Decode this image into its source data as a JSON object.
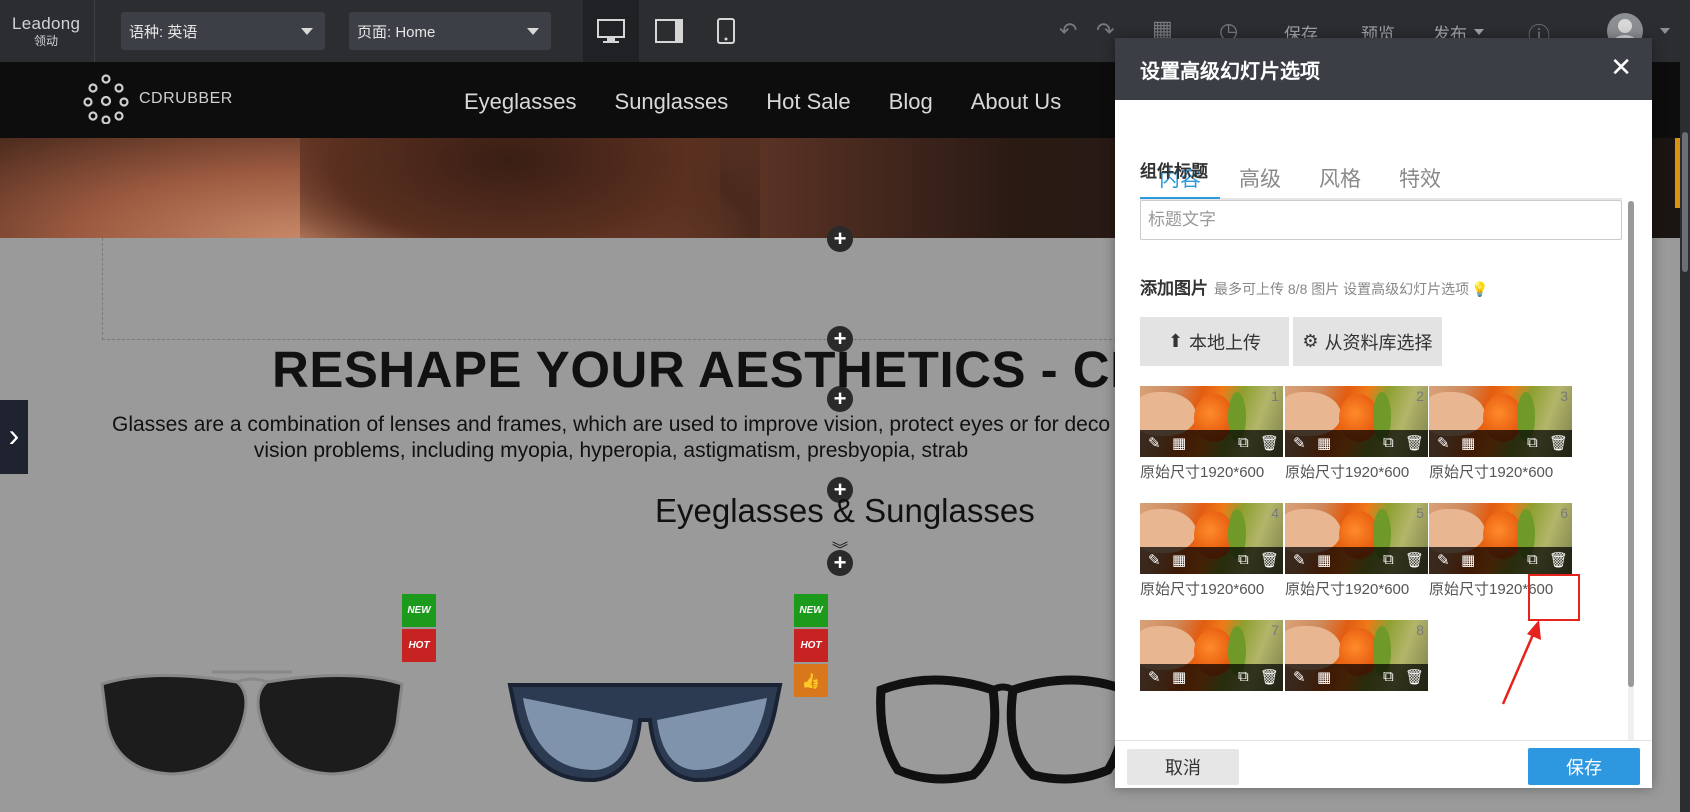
{
  "toolbar": {
    "logo_text": "Leadong",
    "logo_sub": "领动",
    "language_select": "语种: 英语",
    "page_select": "页面: Home",
    "save": "保存",
    "preview": "预览",
    "publish": "发布",
    "devices": [
      "desktop-icon",
      "tablet-icon",
      "mobile-icon"
    ]
  },
  "site": {
    "brand": "CDRUBBER",
    "nav": [
      "Eyeglasses",
      "Sunglasses",
      "Hot Sale",
      "Blog",
      "About Us"
    ],
    "headline": "RESHAPE YOUR AESTHETICS - CHOO",
    "paragraph_line1": "Glasses are a combination of lenses and frames, which are used to improve vision, protect eyes or for deco",
    "paragraph_line2": "vision problems, including myopia, hyperopia, astigmatism, presbyopia, strab",
    "subheading": "Eyeglasses  & Sunglasses",
    "badges": {
      "new": "NEW",
      "hot": "HOT"
    }
  },
  "modal": {
    "title": "设置高级幻灯片选项",
    "tabs": [
      "内容",
      "高级",
      "风格",
      "特效"
    ],
    "active_tab": "内容",
    "component_title_label": "组件标题",
    "title_placeholder": "标题文字",
    "add_image_label": "添加图片",
    "add_image_hint": "最多可上传 8/8 图片 设置高级幻灯片选项",
    "upload_local": "本地上传",
    "choose_library": "从资料库选择",
    "images": [
      {
        "num": "1",
        "caption": "原始尺寸1920*600"
      },
      {
        "num": "2",
        "caption": "原始尺寸1920*600"
      },
      {
        "num": "3",
        "caption": "原始尺寸1920*600"
      },
      {
        "num": "4",
        "caption": "原始尺寸1920*600"
      },
      {
        "num": "5",
        "caption": "原始尺寸1920*600"
      },
      {
        "num": "6",
        "caption": "原始尺寸1920*600"
      },
      {
        "num": "7",
        "caption": ""
      },
      {
        "num": "8",
        "caption": ""
      }
    ],
    "cancel": "取消",
    "save": "保存"
  },
  "colors": {
    "toolbar_bg": "#2b2d31",
    "accent_blue": "#2d98e0",
    "annotation_red": "#e5221b"
  }
}
